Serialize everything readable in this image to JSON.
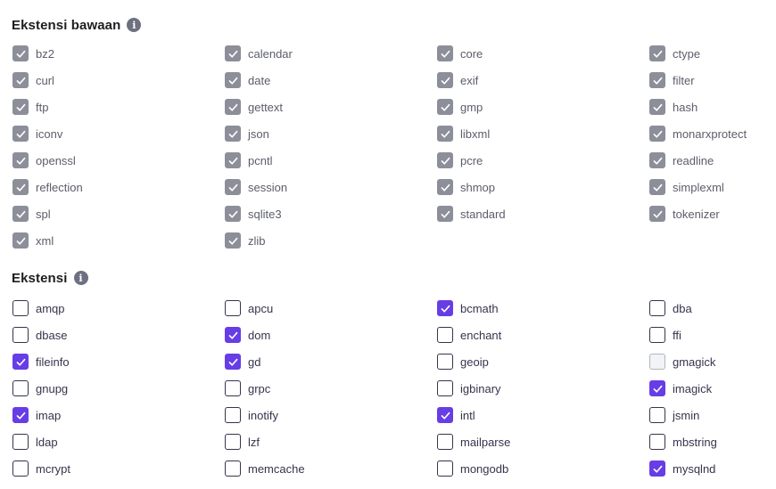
{
  "builtin": {
    "title": "Ekstensi bawaan",
    "info_icon": "info-icon",
    "items": [
      {
        "label": "bz2",
        "state": "builtin"
      },
      {
        "label": "calendar",
        "state": "builtin"
      },
      {
        "label": "core",
        "state": "builtin"
      },
      {
        "label": "ctype",
        "state": "builtin"
      },
      {
        "label": "curl",
        "state": "builtin"
      },
      {
        "label": "date",
        "state": "builtin"
      },
      {
        "label": "exif",
        "state": "builtin"
      },
      {
        "label": "filter",
        "state": "builtin"
      },
      {
        "label": "ftp",
        "state": "builtin"
      },
      {
        "label": "gettext",
        "state": "builtin"
      },
      {
        "label": "gmp",
        "state": "builtin"
      },
      {
        "label": "hash",
        "state": "builtin"
      },
      {
        "label": "iconv",
        "state": "builtin"
      },
      {
        "label": "json",
        "state": "builtin"
      },
      {
        "label": "libxml",
        "state": "builtin"
      },
      {
        "label": "monarxprotect",
        "state": "builtin"
      },
      {
        "label": "openssl",
        "state": "builtin"
      },
      {
        "label": "pcntl",
        "state": "builtin"
      },
      {
        "label": "pcre",
        "state": "builtin"
      },
      {
        "label": "readline",
        "state": "builtin"
      },
      {
        "label": "reflection",
        "state": "builtin"
      },
      {
        "label": "session",
        "state": "builtin"
      },
      {
        "label": "shmop",
        "state": "builtin"
      },
      {
        "label": "simplexml",
        "state": "builtin"
      },
      {
        "label": "spl",
        "state": "builtin"
      },
      {
        "label": "sqlite3",
        "state": "builtin"
      },
      {
        "label": "standard",
        "state": "builtin"
      },
      {
        "label": "tokenizer",
        "state": "builtin"
      },
      {
        "label": "xml",
        "state": "builtin"
      },
      {
        "label": "zlib",
        "state": "builtin"
      }
    ]
  },
  "extensions": {
    "title": "Ekstensi",
    "info_icon": "info-icon",
    "items": [
      {
        "label": "amqp",
        "state": "unchecked"
      },
      {
        "label": "apcu",
        "state": "unchecked"
      },
      {
        "label": "bcmath",
        "state": "checked"
      },
      {
        "label": "dba",
        "state": "unchecked"
      },
      {
        "label": "dbase",
        "state": "unchecked"
      },
      {
        "label": "dom",
        "state": "checked"
      },
      {
        "label": "enchant",
        "state": "unchecked"
      },
      {
        "label": "ffi",
        "state": "unchecked"
      },
      {
        "label": "fileinfo",
        "state": "checked"
      },
      {
        "label": "gd",
        "state": "checked"
      },
      {
        "label": "geoip",
        "state": "unchecked"
      },
      {
        "label": "gmagick",
        "state": "disabled"
      },
      {
        "label": "gnupg",
        "state": "unchecked"
      },
      {
        "label": "grpc",
        "state": "unchecked"
      },
      {
        "label": "igbinary",
        "state": "unchecked"
      },
      {
        "label": "imagick",
        "state": "checked"
      },
      {
        "label": "imap",
        "state": "checked"
      },
      {
        "label": "inotify",
        "state": "unchecked"
      },
      {
        "label": "intl",
        "state": "checked"
      },
      {
        "label": "jsmin",
        "state": "unchecked"
      },
      {
        "label": "ldap",
        "state": "unchecked"
      },
      {
        "label": "lzf",
        "state": "unchecked"
      },
      {
        "label": "mailparse",
        "state": "unchecked"
      },
      {
        "label": "mbstring",
        "state": "unchecked"
      },
      {
        "label": "mcrypt",
        "state": "unchecked"
      },
      {
        "label": "memcache",
        "state": "unchecked"
      },
      {
        "label": "mongodb",
        "state": "unchecked"
      },
      {
        "label": "mysqlnd",
        "state": "checked"
      }
    ]
  },
  "colors": {
    "accent": "#673de6",
    "builtin_checkbox": "#8c8e99",
    "text": "#36344d",
    "title": "#1d1e20"
  }
}
